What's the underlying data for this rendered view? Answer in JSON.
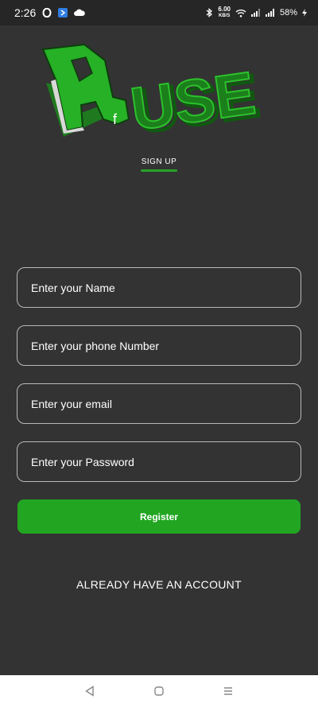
{
  "status_bar": {
    "time": "2:26",
    "net_speed_value": "6.00",
    "net_speed_unit": "KB/S",
    "battery": "58%",
    "icons": [
      "opera-icon",
      "app-icon",
      "cloud-icon",
      "bluetooth-icon",
      "wifi-icon",
      "signal-icon",
      "signal-icon-2",
      "charging-icon"
    ]
  },
  "logo": {
    "text": "USE",
    "small_letter": "f",
    "brand_color": "#22a622"
  },
  "tab": {
    "label": "SIGN UP"
  },
  "form": {
    "name_placeholder": "Enter your Name",
    "phone_placeholder": "Enter your phone Number",
    "email_placeholder": "Enter your email",
    "password_placeholder": "Enter your Password",
    "register_label": "Register"
  },
  "footer": {
    "login_link": "ALREADY HAVE AN ACCOUNT"
  },
  "nav": {
    "icons": [
      "back-icon",
      "home-icon",
      "menu-icon"
    ]
  },
  "colors": {
    "background": "#333333",
    "accent": "#22a622",
    "field_border": "#b8b8b8"
  }
}
